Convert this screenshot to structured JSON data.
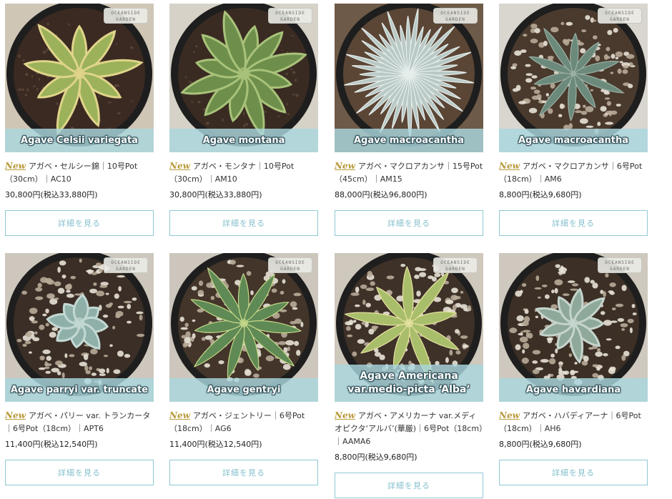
{
  "brand_label": "OCEANSIDE GARDEN",
  "new_badge": "New",
  "detail_button": "詳細を見る",
  "colors": {
    "accent": "#86c1cd",
    "banner": "#aad7de",
    "new_badge": "#b99a3c"
  },
  "products": [
    {
      "banner": "Agave Celsii variegata",
      "title": "アガベ・セルシー錦｜10号Pot（30cm）｜AC10",
      "price": "30,800円(税込33,880円)",
      "plant": "variegated-rosette"
    },
    {
      "banner": "Agave montana",
      "title": "アガベ・モンタナ｜10号Pot（30cm）｜AM10",
      "price": "30,800円(税込33,880円)",
      "plant": "green-rosette"
    },
    {
      "banner": "Agave macroacantha",
      "title": "アガベ・マクロアカンサ｜15号Pot（45cm）｜AM15",
      "price": "88,000円(税込96,800円)",
      "plant": "spiky-blue-rosette"
    },
    {
      "banner": "Agave macroacantha",
      "title": "アガベ・マクロアカンサ｜6号Pot（18cm）｜AM6",
      "price": "8,800円(税込9,680円)",
      "plant": "small-blue-rosette"
    },
    {
      "banner": "Agave parryi var. truncate",
      "title": "アガベ・パリー var. トランカータ｜6号Pot（18cm）｜APT6",
      "price": "11,400円(税込12,540円)",
      "plant": "compact-blue-rosette"
    },
    {
      "banner": "Agave gentryi",
      "title": "アガベ・ジェントリー｜6号Pot（18cm）｜AG6",
      "price": "11,400円(税込12,540円)",
      "plant": "toothed-green-rosette"
    },
    {
      "banner": "Agave Americana var.medio-picta ‘Alba’",
      "title": "アガベ・アメリカーナ var.メディオピクタ‘アルバ’(華厳)｜6号Pot（18cm）｜AAMA6",
      "price": "8,800円(税込9,680円)",
      "plant": "striped-rosette"
    },
    {
      "banner": "Agave havardiana",
      "title": "アガベ・ハバディアーナ｜6号Pot（18cm）｜AH6",
      "price": "8,800円(税込9,680円)",
      "plant": "gray-rosette"
    }
  ]
}
